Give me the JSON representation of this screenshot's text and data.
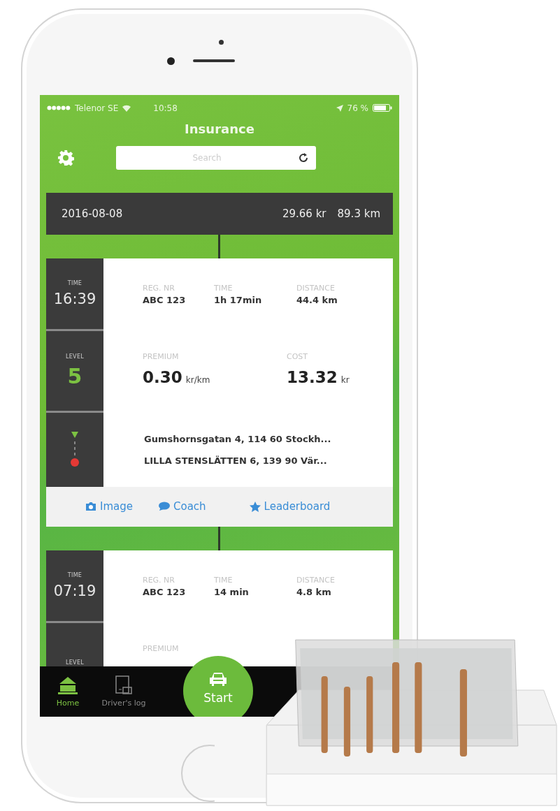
{
  "status_bar": {
    "carrier": "Telenor SE",
    "time": "10:58",
    "battery": "76 %"
  },
  "header": {
    "title": "Insurance",
    "search": {
      "placeholder": "Search"
    }
  },
  "day": {
    "date": "2016-08-08",
    "cost": "29.66 kr",
    "distance": "89.3 km"
  },
  "trips": [
    {
      "time_label": "TIME",
      "time": "16:39",
      "fields": [
        {
          "label": "REG. NR",
          "value": "ABC 123"
        },
        {
          "label": "TIME",
          "value": "1h 17min"
        },
        {
          "label": "DISTANCE",
          "value": "44.4 km"
        }
      ],
      "level_label": "LEVEL",
      "level": "5",
      "premium": {
        "label": "PREMIUM",
        "value": "0.30",
        "unit": "kr/km"
      },
      "cost": {
        "label": "COST",
        "value": "13.32",
        "unit": "kr"
      },
      "route": {
        "from": "Gumshornsgatan 4, 114 60 Stockh...",
        "to": "LILLA STENSLÄTTEN 6, 139 90 Vär..."
      },
      "actions": [
        {
          "kind": "camera",
          "label": "Image"
        },
        {
          "kind": "chat",
          "label": "Coach"
        },
        {
          "kind": "star",
          "label": "Leaderboard"
        }
      ]
    },
    {
      "time_label": "TIME",
      "time": "07:19",
      "fields": [
        {
          "label": "REG. NR",
          "value": "ABC 123"
        },
        {
          "label": "TIME",
          "value": "14 min"
        },
        {
          "label": "DISTANCE",
          "value": "4.8 km"
        }
      ],
      "level_label": "LEVEL",
      "premium": {
        "label": "PREMIUM"
      }
    }
  ],
  "tab_bar": {
    "items": [
      {
        "kind": "home",
        "label": "Home",
        "selected": true
      },
      {
        "kind": "log",
        "label": "Driver's log",
        "selected": false
      }
    ],
    "start": {
      "label": "Start"
    }
  }
}
